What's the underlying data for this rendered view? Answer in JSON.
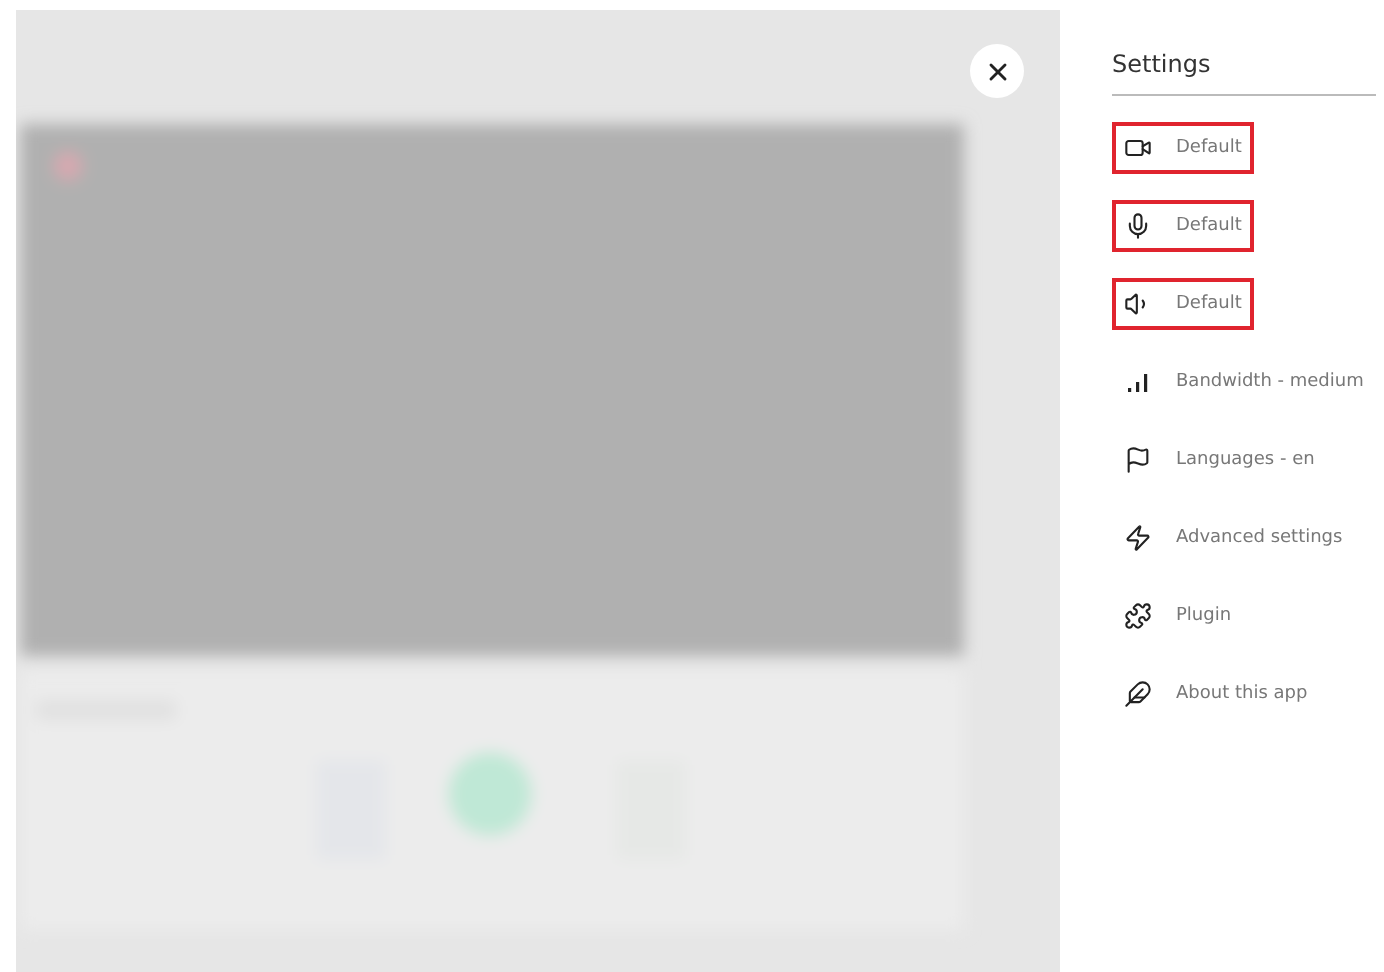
{
  "settings": {
    "title": "Settings",
    "items": [
      {
        "label": "Default",
        "highlighted": true
      },
      {
        "label": "Default",
        "highlighted": true
      },
      {
        "label": "Default",
        "highlighted": true
      },
      {
        "label": "Bandwidth - medium",
        "highlighted": false
      },
      {
        "label": "Languages - en",
        "highlighted": false
      },
      {
        "label": "Advanced settings",
        "highlighted": false
      },
      {
        "label": "Plugin",
        "highlighted": false
      },
      {
        "label": "About this app",
        "highlighted": false
      }
    ]
  }
}
